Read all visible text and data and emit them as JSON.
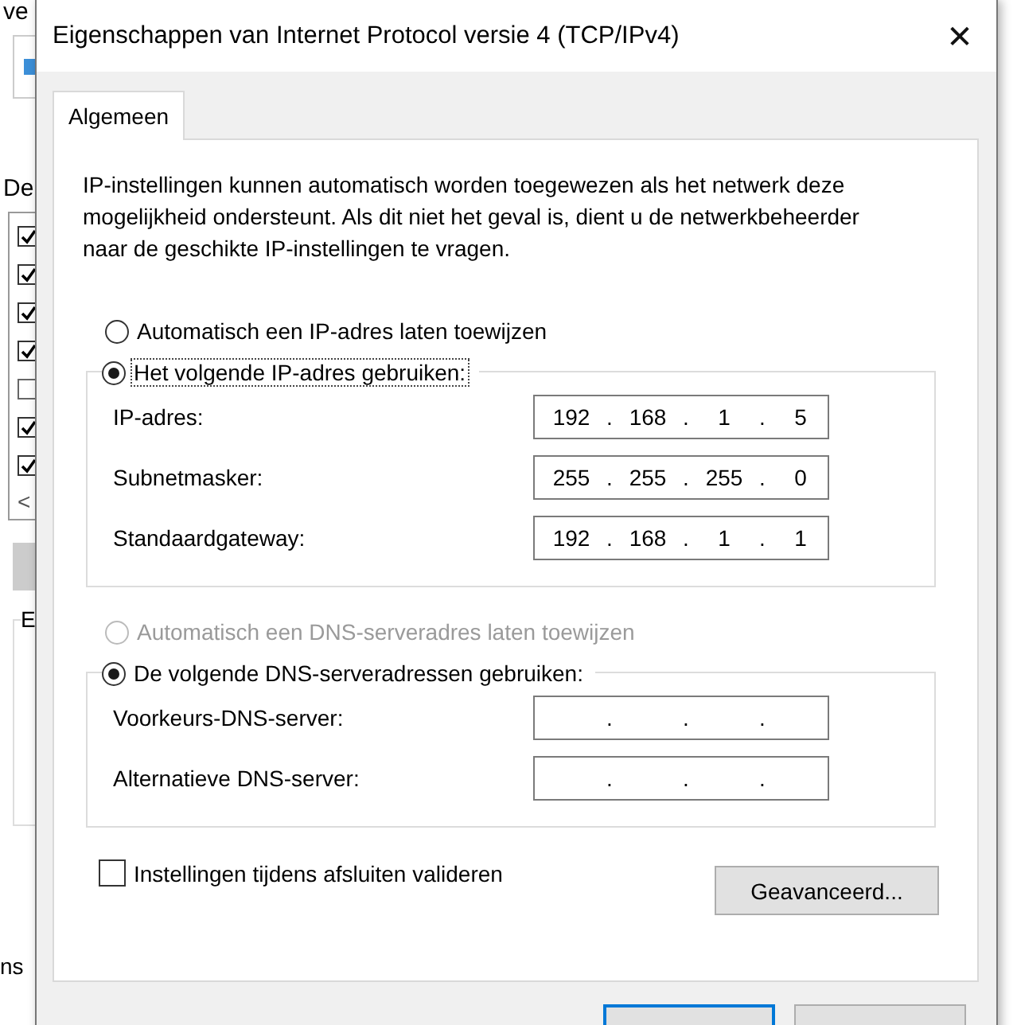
{
  "background_window": {
    "title": "ve",
    "list_label": "De",
    "items": [
      {
        "checked": true
      },
      {
        "checked": true
      },
      {
        "checked": true
      },
      {
        "checked": true
      },
      {
        "checked": false
      },
      {
        "checked": true
      },
      {
        "checked": true
      }
    ],
    "scroll_arrow": "<",
    "group_label": "E",
    "footer": "ns"
  },
  "window": {
    "title": "Eigenschappen van Internet Protocol versie 4 (TCP/IPv4)",
    "close": "✕"
  },
  "tabs": [
    {
      "label": "Algemeen",
      "selected": true
    }
  ],
  "description": "IP-instellingen kunnen automatisch worden toegewezen als het netwerk deze mogelijkheid ondersteunt. Als dit niet het geval is, dient u de netwerkbeheerder naar de geschikte IP-instellingen te vragen.",
  "sections": [
    {
      "auto": {
        "label": "Automatisch een IP-adres laten toewijzen",
        "selected": false,
        "disabled": false,
        "focused": false
      },
      "manual": {
        "label": "Het volgende IP-adres gebruiken:",
        "selected": true,
        "disabled": false,
        "focused": true
      },
      "fields": [
        {
          "label": "IP-adres:",
          "segments": [
            {
              "kind": "octet",
              "text": "192"
            },
            {
              "kind": "dot",
              "text": "."
            },
            {
              "kind": "octet",
              "text": "168"
            },
            {
              "kind": "dot",
              "text": "."
            },
            {
              "kind": "octet",
              "text": "1"
            },
            {
              "kind": "dot",
              "text": "."
            },
            {
              "kind": "octet",
              "text": "5"
            }
          ]
        },
        {
          "label": "Subnetmasker:",
          "segments": [
            {
              "kind": "octet",
              "text": "255"
            },
            {
              "kind": "dot",
              "text": "."
            },
            {
              "kind": "octet",
              "text": "255"
            },
            {
              "kind": "dot",
              "text": "."
            },
            {
              "kind": "octet",
              "text": "255"
            },
            {
              "kind": "dot",
              "text": "."
            },
            {
              "kind": "octet",
              "text": "0"
            }
          ]
        },
        {
          "label": "Standaardgateway:",
          "segments": [
            {
              "kind": "octet",
              "text": "192"
            },
            {
              "kind": "dot",
              "text": "."
            },
            {
              "kind": "octet",
              "text": "168"
            },
            {
              "kind": "dot",
              "text": "."
            },
            {
              "kind": "octet",
              "text": "1"
            },
            {
              "kind": "dot",
              "text": "."
            },
            {
              "kind": "octet",
              "text": "1"
            }
          ]
        }
      ]
    },
    {
      "auto": {
        "label": "Automatisch een DNS-serveradres laten toewijzen",
        "selected": false,
        "disabled": true,
        "focused": false
      },
      "manual": {
        "label": "De volgende DNS-serveradressen gebruiken:",
        "selected": true,
        "disabled": false,
        "focused": false
      },
      "fields": [
        {
          "label": "Voorkeurs-DNS-server:",
          "segments": [
            {
              "kind": "dot",
              "text": "."
            },
            {
              "kind": "dot",
              "text": "."
            },
            {
              "kind": "dot",
              "text": "."
            }
          ]
        },
        {
          "label": "Alternatieve DNS-server:",
          "segments": [
            {
              "kind": "dot",
              "text": "."
            },
            {
              "kind": "dot",
              "text": "."
            },
            {
              "kind": "dot",
              "text": "."
            }
          ]
        }
      ]
    }
  ],
  "validate": {
    "label": "Instellingen tijdens afsluiten valideren",
    "checked": false
  },
  "advanced_button": "Geavanceerd...",
  "footer_buttons": [
    {
      "default": true
    },
    {
      "default": false
    }
  ]
}
